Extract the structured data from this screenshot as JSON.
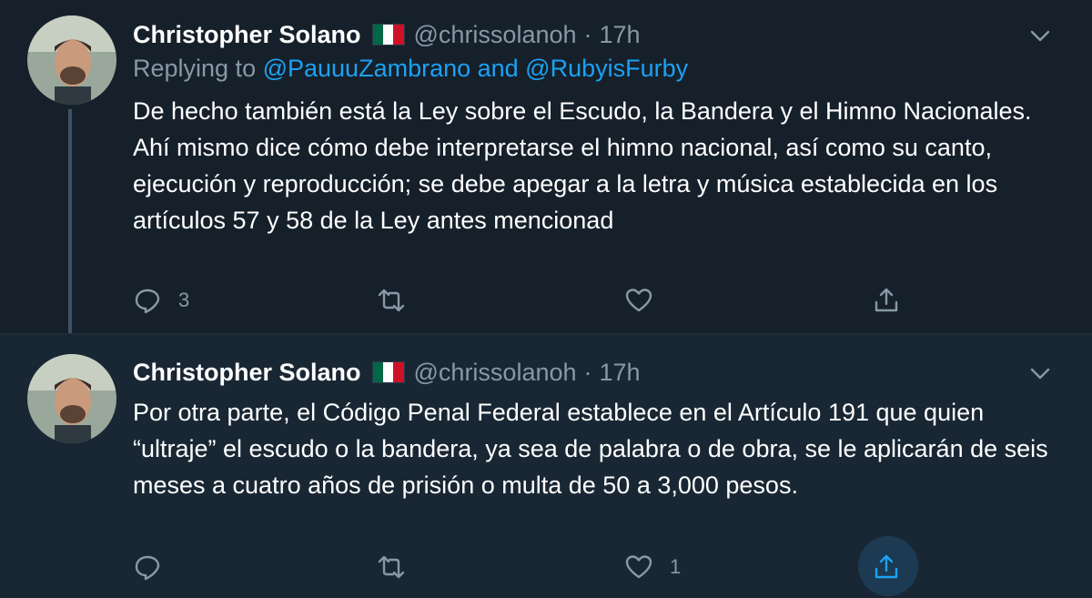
{
  "colors": {
    "background": "#15202b",
    "background_alt": "#192734",
    "accent": "#1da1f2",
    "muted": "#8899a6"
  },
  "tweets": [
    {
      "author_name": "Christopher Solano",
      "flag_icon": "mexico-flag-icon",
      "handle": "@chrissolanoh",
      "separator": "·",
      "time": "17h",
      "replying_prefix": "Replying to ",
      "replying_mentions": "@PauuuZambrano and @RubyisFurby",
      "body_lines": [
        "De hecho también está la Ley sobre el Escudo, la Bandera y el Himno Nacionales.",
        "Ahí mismo dice cómo debe interpretarse el himno nacional, así como su canto, ejecución y reproducción; se debe apegar a la letra y música establecida en los artículos 57 y 58 de la Ley antes mencionad"
      ],
      "reply_count": "3",
      "retweet_count": "",
      "like_count": ""
    },
    {
      "author_name": "Christopher Solano",
      "flag_icon": "mexico-flag-icon",
      "handle": "@chrissolanoh",
      "separator": "·",
      "time": "17h",
      "body_lines": [
        "Por otra parte, el Código Penal Federal establece en el Artículo 191 que quien “ultraje” el escudo o la bandera, ya sea de palabra o de obra, se le aplicarán de seis meses a cuatro años de prisión o multa de 50 a 3,000 pesos."
      ],
      "reply_count": "",
      "retweet_count": "",
      "like_count": "1"
    }
  ]
}
